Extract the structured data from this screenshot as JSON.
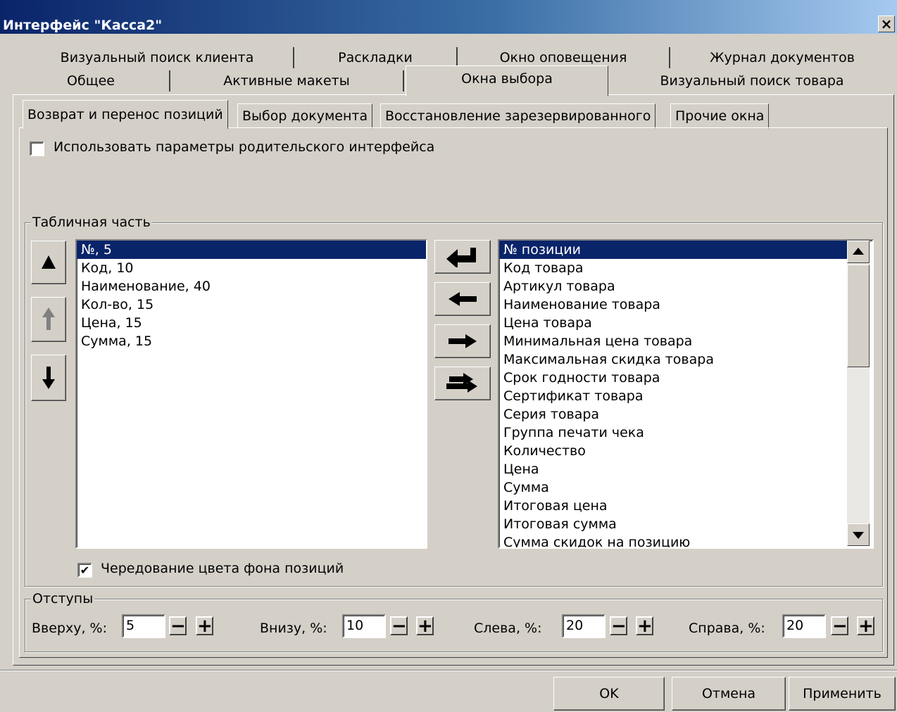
{
  "window": {
    "title": "Интерфейс \"Касса2\"",
    "close": "×"
  },
  "outer_tabs_row1": [
    "Визуальный поиск клиента",
    "Раскладки",
    "Окно оповещения",
    "Журнал документов"
  ],
  "outer_tabs_row2": [
    "Общее",
    "Активные макеты",
    "Окна выбора",
    "Визуальный поиск товара"
  ],
  "inner_tabs": [
    "Возврат и перенос позиций",
    "Выбор документа",
    "Восстановление зарезервированного",
    "Прочие окна"
  ],
  "use_parent_params": {
    "label": "Использовать параметры родительского интерфейса",
    "checked": false
  },
  "table_group": {
    "label": "Табличная часть",
    "selected_columns": [
      "№, 5",
      "Код, 10",
      "Наименование, 40",
      "Кол-во, 15",
      "Цена, 15",
      "Сумма, 15"
    ],
    "available_columns": [
      "№ позиции",
      "Код товара",
      "Артикул товара",
      "Наименование товара",
      "Цена товара",
      "Минимальная цена товара",
      "Максимальная скидка товара",
      "Срок годности товара",
      "Сертификат товара",
      "Серия товара",
      "Группа печати чека",
      "Количество",
      "Цена",
      "Сумма",
      "Итоговая цена",
      "Итоговая сумма",
      "Сумма скидок на позицию"
    ],
    "alternate_colors": {
      "label": "Чередование цвета фона позиций",
      "checked": true
    }
  },
  "margins": {
    "label": "Отступы",
    "top": {
      "label": "Вверху, %:",
      "value": "5"
    },
    "bottom": {
      "label": "Внизу, %:",
      "value": "10"
    },
    "left": {
      "label": "Слева, %:",
      "value": "20"
    },
    "right": {
      "label": "Справа, %:",
      "value": "20"
    },
    "minus": "−",
    "plus": "+"
  },
  "dialog_buttons": {
    "ok": "OK",
    "cancel": "Отмена",
    "apply": "Применить"
  },
  "checkmark": "✔",
  "colors": {
    "selection": "#0a246a",
    "face": "#d4d0c8"
  }
}
